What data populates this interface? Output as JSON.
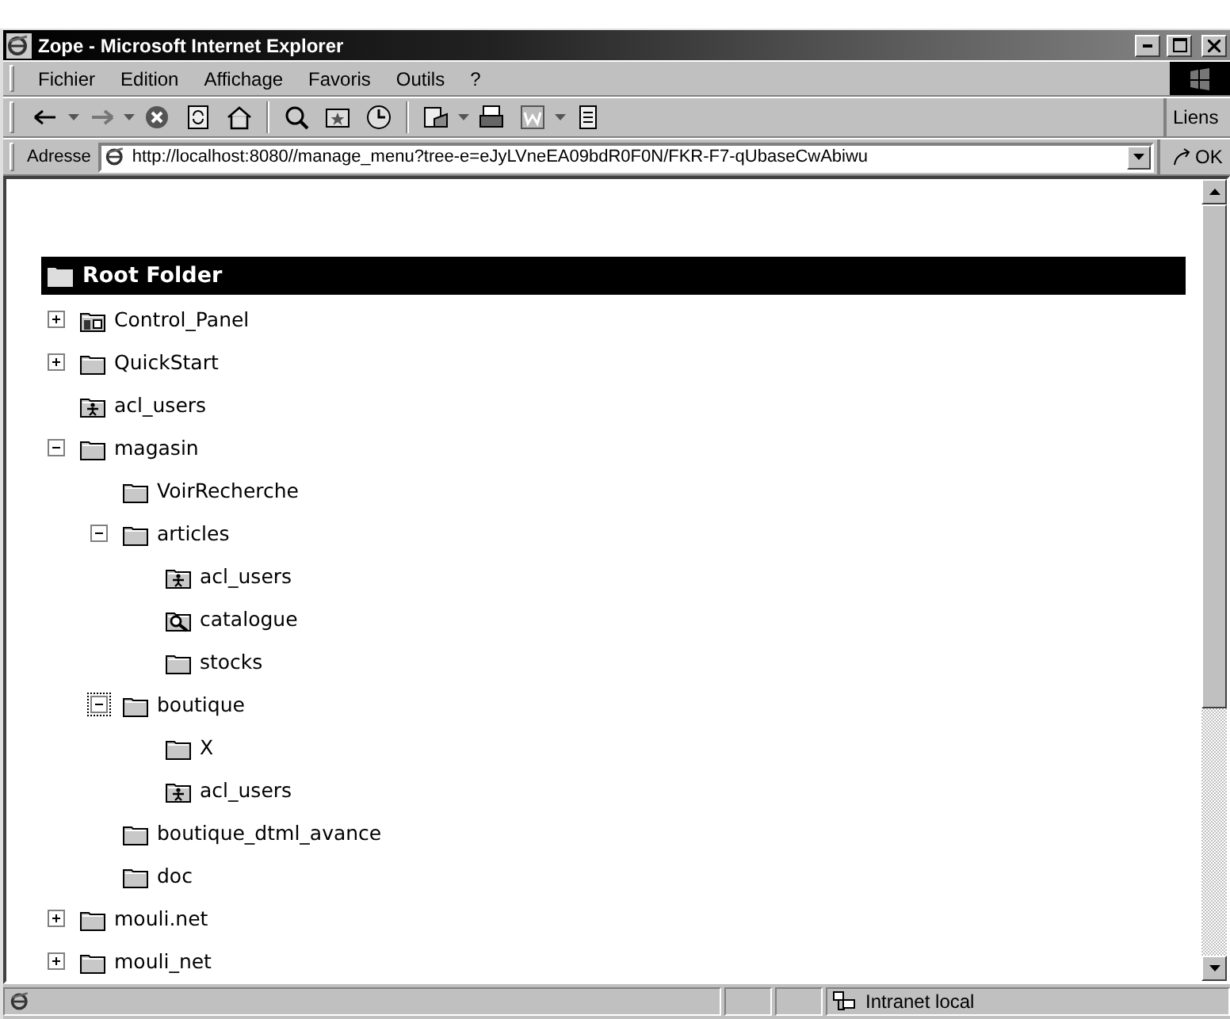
{
  "window": {
    "title": "Zope - Microsoft Internet Explorer"
  },
  "menu": [
    "Fichier",
    "Edition",
    "Affichage",
    "Favoris",
    "Outils",
    "?"
  ],
  "links_label": "Liens",
  "address": {
    "label": "Adresse",
    "value": "http://localhost:8080//manage_menu?tree-e=eJyLVneEA09bdR0F0N/FKR-F7-qUbaseCwAbiwu",
    "go": "OK"
  },
  "tree": {
    "root": "Root Folder",
    "items": [
      {
        "label": "Control_Panel",
        "kind": "control-panel",
        "expanded": false,
        "focused": false
      },
      {
        "label": "QuickStart",
        "kind": "folder",
        "expanded": false,
        "focused": false
      },
      {
        "label": "acl_users",
        "kind": "user-folder",
        "focused": false
      },
      {
        "label": "magasin",
        "kind": "folder",
        "expanded": true,
        "focused": false,
        "children": [
          {
            "label": "VoirRecherche",
            "kind": "folder",
            "focused": false
          },
          {
            "label": "articles",
            "kind": "folder",
            "expanded": true,
            "focused": false,
            "children": [
              {
                "label": "acl_users",
                "kind": "user-folder",
                "focused": false
              },
              {
                "label": "catalogue",
                "kind": "catalog",
                "focused": false
              },
              {
                "label": "stocks",
                "kind": "folder",
                "focused": false
              }
            ]
          },
          {
            "label": "boutique",
            "kind": "folder",
            "expanded": true,
            "focused": true,
            "children": [
              {
                "label": "X",
                "kind": "folder",
                "focused": false
              },
              {
                "label": "acl_users",
                "kind": "user-folder",
                "focused": false
              }
            ]
          },
          {
            "label": "boutique_dtml_avance",
            "kind": "folder",
            "focused": false
          },
          {
            "label": "doc",
            "kind": "folder",
            "focused": false
          }
        ]
      },
      {
        "label": "mouli.net",
        "kind": "folder",
        "expanded": false,
        "focused": false
      },
      {
        "label": "mouli_net",
        "kind": "folder",
        "expanded": false,
        "focused": false
      }
    ]
  },
  "status_bar": {
    "zone": "Intranet local"
  }
}
